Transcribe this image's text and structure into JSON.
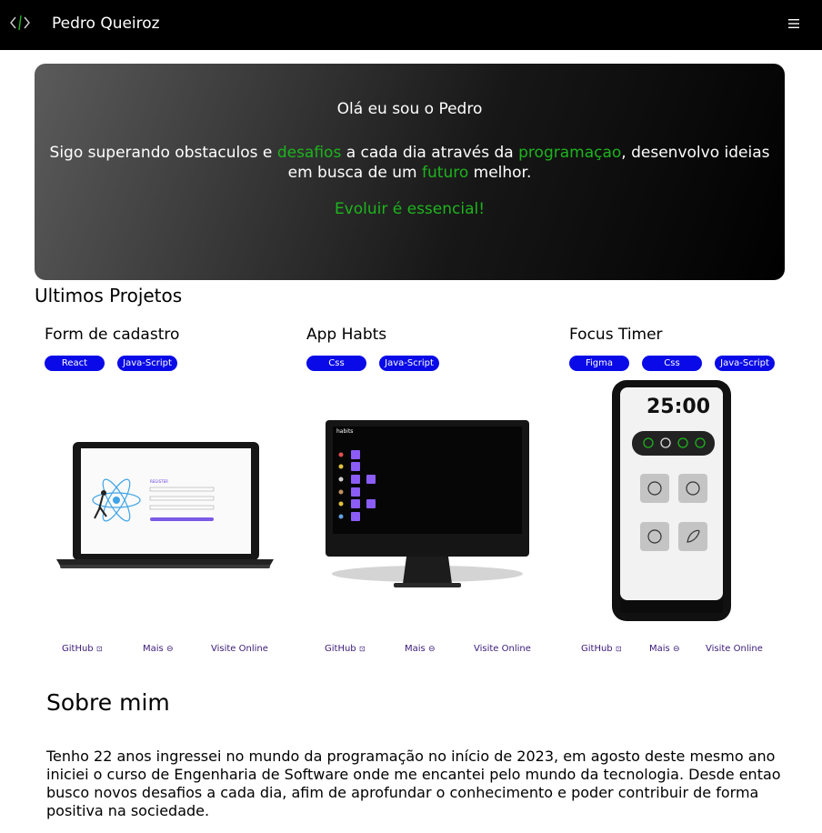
{
  "header": {
    "logo_icon": "code-brackets-icon",
    "site_name": "Pedro Queiroz",
    "menu_icon": "hamburger-menu-icon"
  },
  "hero": {
    "greeting": "Olá eu sou o Pedro",
    "text_1": "Sigo superando obstaculos e ",
    "hl_1": "desafios",
    "text_2": " a cada dia através da ",
    "hl_2": "programaçao",
    "text_3": ", desenvolvo ideias em busca de um ",
    "hl_3": "futuro",
    "text_4": " melhor.",
    "motto": "Evoluir é essencial!",
    "accent_color": "#1db41d"
  },
  "projects": {
    "title": "Ultimos Projetos",
    "tag_color": "#0a0ae8",
    "items": [
      {
        "title": "Form de cadastro",
        "tags": [
          "React",
          "Java-Script"
        ],
        "image": "laptop-mockup",
        "links": {
          "github": "GitHub",
          "github_icon": "github-icon",
          "more": "Mais",
          "more_icon": "more-circle-icon",
          "online": "Visite Online"
        }
      },
      {
        "title": "App Habts",
        "tags": [
          "Css",
          "Java-Script"
        ],
        "image": "monitor-mockup",
        "links": {
          "github": "GitHub",
          "github_icon": "github-icon",
          "more": "Mais",
          "more_icon": "more-circle-icon",
          "online": "Visite Online"
        }
      },
      {
        "title": "Focus Timer",
        "tags": [
          "Figma",
          "Css",
          "Java-Script"
        ],
        "image": "phone-mockup",
        "timer": "25:00",
        "links": {
          "github": "GitHub",
          "github_icon": "github-icon",
          "more": "Mais",
          "more_icon": "more-circle-icon",
          "online": "Visite Online"
        }
      }
    ]
  },
  "about": {
    "title": "Sobre mim",
    "text": "Tenho 22 anos ingressei no mundo da programação no início de 2023, em agosto deste mesmo ano iniciei o curso de Engenharia de Software onde me encantei pelo mundo da tecnologia. Desde entao busco novos desafios a cada dia, afim de aprofundar o conhecimento e poder contribuir de forma positiva na sociedade."
  }
}
